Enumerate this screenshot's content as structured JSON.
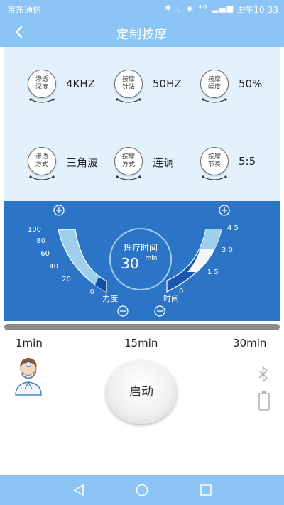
{
  "status": {
    "carrier": "京东通信",
    "icons": "✱ ▯ ◉ ⁴ᴳ ▂▄▆ ▭",
    "time": "上午10:33"
  },
  "header": {
    "back_icon": "chevron-left-icon",
    "title": "定制按摩"
  },
  "params": [
    {
      "l1": "渗透",
      "l2": "深度",
      "value": "4KHZ"
    },
    {
      "l1": "按摩",
      "l2": "针法",
      "value": "50HZ"
    },
    {
      "l1": "按摩",
      "l2": "幅度",
      "value": "50%"
    },
    {
      "l1": "渗透",
      "l2": "方式",
      "value": "三角波"
    },
    {
      "l1": "按摩",
      "l2": "方式",
      "value": "连调"
    },
    {
      "l1": "按摩",
      "l2": "节奏",
      "value": "5:5"
    }
  ],
  "gauge": {
    "force_ticks": [
      "100",
      "80",
      "60",
      "40",
      "20",
      "0"
    ],
    "force_label": "力度",
    "time_ticks": [
      "4 5",
      "3 0",
      "1 5",
      "0"
    ],
    "time_label": "时间",
    "center_title": "理疗时间",
    "center_value": "30",
    "center_unit": "min",
    "force_level": 0.9,
    "time_level": 0.67
  },
  "timeline": {
    "labels": [
      "1min",
      "15min",
      "30min"
    ]
  },
  "controls": {
    "start_label": "启动",
    "bluetooth_icon": "bluetooth-icon",
    "battery_icon": "battery-icon"
  },
  "colors": {
    "primary": "#8cc5f5",
    "panel": "#2c74c6",
    "params_bg": "#e2f1fb"
  }
}
